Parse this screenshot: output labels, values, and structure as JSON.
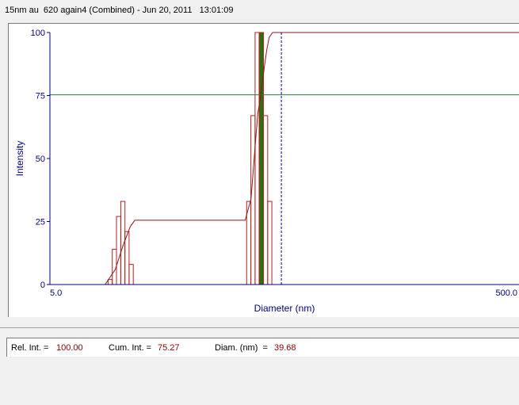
{
  "window": {
    "title": "15nm au  620 again4 (Combined) - Jun 20, 2011   13:01:09"
  },
  "chart_data": {
    "type": "bar",
    "ylabel": "Intensity",
    "xlabel": "Diameter (nm)",
    "x_scale": "log",
    "xlim": [
      5.0,
      500.0
    ],
    "ylim": [
      0,
      100
    ],
    "x_tick_labels": [
      "5.0",
      "500.0"
    ],
    "y_tick_labels": [
      "0",
      "25",
      "50",
      "75",
      "100"
    ],
    "bins": [
      {
        "x0": 8.85,
        "x1": 9.22,
        "value": 2
      },
      {
        "x0": 9.22,
        "x1": 9.61,
        "value": 14
      },
      {
        "x0": 9.61,
        "x1": 10.02,
        "value": 27
      },
      {
        "x0": 10.02,
        "x1": 10.44,
        "value": 33
      },
      {
        "x0": 10.44,
        "x1": 10.88,
        "value": 21
      },
      {
        "x0": 10.88,
        "x1": 11.34,
        "value": 8
      },
      {
        "x0": 34.5,
        "x1": 35.95,
        "value": 33
      },
      {
        "x0": 35.95,
        "x1": 37.46,
        "value": 67
      },
      {
        "x0": 37.46,
        "x1": 39.04,
        "value": 100
      },
      {
        "x0": 39.04,
        "x1": 40.69,
        "value": 100
      },
      {
        "x0": 40.69,
        "x1": 42.4,
        "value": 67
      },
      {
        "x0": 42.4,
        "x1": 44.19,
        "value": 33
      }
    ],
    "cumulative_curve": {
      "x": [
        8.6,
        9.5,
        10.3,
        11.0,
        11.5,
        34.0,
        36.0,
        37.5,
        38.5,
        39.68,
        41.0,
        42.0,
        43.0,
        44.5,
        500.0
      ],
      "y": [
        0,
        6,
        16,
        23,
        25.5,
        25.5,
        34,
        55,
        68,
        75.27,
        86,
        93,
        98,
        100,
        100
      ]
    },
    "selected_diameter": 39.68,
    "cumulative_level": 75.27,
    "dashed_marker_x": 48.5,
    "colors": {
      "bars": "#b22222",
      "curve": "#8b1a1a",
      "selection": "#2e6e12",
      "horizontal_line": "#2e7d32",
      "axis_text": "#000080",
      "status_values": "#8b0000"
    }
  },
  "status": {
    "rel_int_label": "Rel. Int. =",
    "rel_int_value": "100.00",
    "cum_int_label": "Cum. Int. =",
    "cum_int_value": "75.27",
    "diam_label": "Diam. (nm)  =",
    "diam_value": "39.68"
  }
}
